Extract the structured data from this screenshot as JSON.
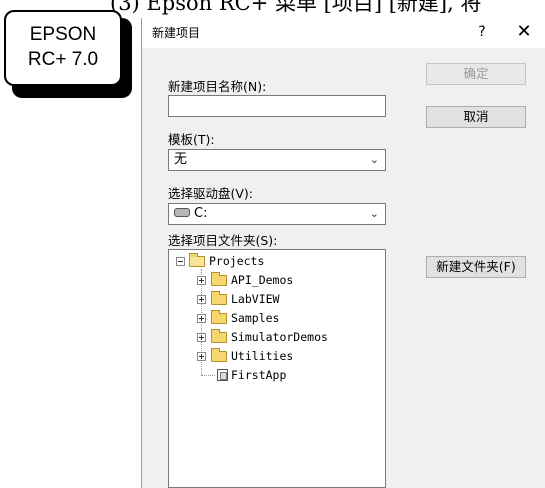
{
  "heading_fragment": "(3) Epson RC+ 菜单 [项目] [新建], 将",
  "badge": {
    "line1": "EPSON",
    "line2": "RC+ 7.0"
  },
  "dialog": {
    "title": "新建项目",
    "help_label": "?",
    "close_label": "✕",
    "name_label": "新建项目名称(N):",
    "name_value": "",
    "template_label": "模板(T):",
    "template_value": "无",
    "drive_label": "选择驱动盘(V):",
    "drive_value": "C:",
    "folder_label": "选择项目文件夹(S):",
    "ok_button": "确定",
    "cancel_button": "取消",
    "new_folder_button": "新建文件夹(F)",
    "tree": {
      "root": "Projects",
      "children": [
        "API_Demos",
        "LabVIEW",
        "Samples",
        "SimulatorDemos",
        "Utilities",
        "FirstApp"
      ]
    }
  }
}
